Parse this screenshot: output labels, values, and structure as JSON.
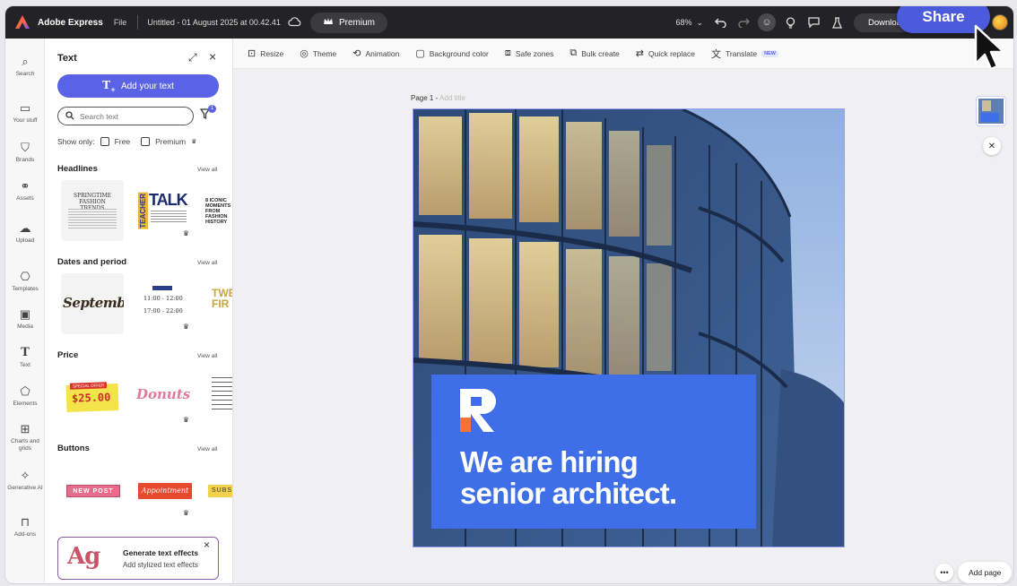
{
  "app": {
    "brand": "Adobe Express",
    "file_menu": "File",
    "doc_title": "Untitled - 01 August 2025 at 00.42.41",
    "premium_label": "Premium",
    "zoom": "68%",
    "download_label": "Download",
    "share_label": "Share"
  },
  "rail": [
    {
      "label": "Search",
      "icon": "search-icon"
    },
    {
      "label": "Your stuff",
      "icon": "folder-icon"
    },
    {
      "label": "Brands",
      "icon": "brand-icon"
    },
    {
      "label": "Assets",
      "icon": "assets-icon"
    },
    {
      "label": "Upload",
      "icon": "upload-icon"
    },
    {
      "label": "Templates",
      "icon": "templates-icon"
    },
    {
      "label": "Media",
      "icon": "media-icon"
    },
    {
      "label": "Text",
      "icon": "text-icon"
    },
    {
      "label": "Elements",
      "icon": "elements-icon"
    },
    {
      "label": "Charts and grids",
      "icon": "charts-icon"
    },
    {
      "label": "Generative AI",
      "icon": "generative-ai-icon"
    },
    {
      "label": "Add-ons",
      "icon": "addons-icon"
    }
  ],
  "panel": {
    "title": "Text",
    "add_text": "Add your text",
    "search_placeholder": "Search text",
    "filter_count": "1",
    "show_only": "Show only:",
    "free": "Free",
    "premium": "Premium",
    "view_all": "View all",
    "sections": {
      "headlines": "Headlines",
      "dates": "Dates and period",
      "price": "Price",
      "buttons": "Buttons"
    },
    "thumbs": {
      "springtime": "SPRINGTIME FASHION TRENDS",
      "teacher": "TEACHER",
      "talk": "TALK",
      "iconic": "8 ICONIC MOMENTS FROM FASHION HISTORY",
      "september": "September",
      "time1": "11:00 - 12:00",
      "time2": "17:00 - 22:00",
      "tweet": "TWEE FIR",
      "special": "SPECIAL OFFER",
      "price": "$25.00",
      "donuts": "Donuts",
      "new_post": "NEW POST",
      "appointment": "Appointment",
      "subscribe": "SUBSC"
    },
    "gen_card": {
      "glyph": "Ag",
      "title": "Generate text effects",
      "subtitle": "Add stylized text effects"
    }
  },
  "toolbar": [
    {
      "label": "Resize",
      "icon": "resize-icon"
    },
    {
      "label": "Theme",
      "icon": "theme-icon"
    },
    {
      "label": "Animation",
      "icon": "animation-icon"
    },
    {
      "label": "Background color",
      "icon": "background-color-icon"
    },
    {
      "label": "Safe zones",
      "icon": "safe-zones-icon"
    },
    {
      "label": "Bulk create",
      "icon": "bulk-create-icon"
    },
    {
      "label": "Quick replace",
      "icon": "quick-replace-icon"
    },
    {
      "label": "Translate",
      "icon": "translate-icon"
    }
  ],
  "translate_badge": "NEW",
  "canvas": {
    "page_label": "Page 1 - ",
    "page_title_placeholder": "Add title",
    "headline_line1": "We are hiring",
    "headline_line2": "senior architect.",
    "add_page": "Add page",
    "more": "•••"
  },
  "colors": {
    "accent": "#5a62e5",
    "share": "#4b5bdc",
    "card_blue": "#3e6ee8",
    "logo_orange": "#f5733a"
  }
}
